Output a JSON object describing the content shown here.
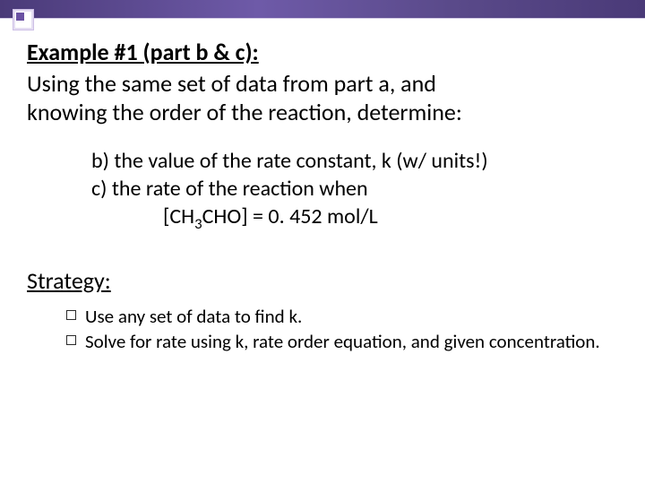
{
  "heading": "Example #1 (part b & c):",
  "intro_line1": "Using the same set of data from part a, and",
  "intro_line2": "knowing the order of the reaction, determine:",
  "part_b": "b) the value of the rate constant, k (w/ units!)",
  "part_c": "c) the rate of the reaction when",
  "formula_prefix": "[CH",
  "formula_sub": "3",
  "formula_suffix": "CHO] = 0. 452 mol/L",
  "strategy_label": "Strategy:",
  "bullets": [
    "Use any set of data to find k.",
    "Solve for rate using k, rate order equation, and given concentration."
  ]
}
